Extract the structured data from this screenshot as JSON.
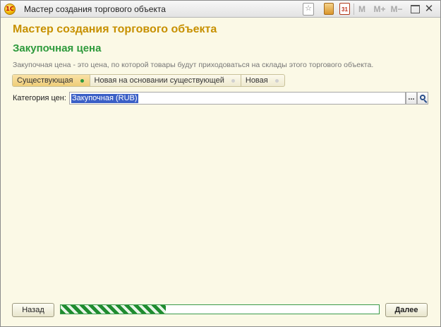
{
  "window": {
    "title": "Мастер создания торгового объекта",
    "app_icon_text": "1С",
    "toolbar": {
      "favorite_glyph": "☆",
      "calendar_text": "31",
      "m_label": "M",
      "m_plus_label": "M+",
      "m_minus_label": "M−",
      "close_glyph": "✕"
    }
  },
  "header": {
    "title": "Мастер создания торгового объекта",
    "page_title": "Закупочная цена",
    "description": "Закупочная цена - это цена, по которой товары будут приходоваться на склады этого торгового объекта."
  },
  "tabs": [
    {
      "label": "Существующая",
      "active": true
    },
    {
      "label": "Новая на основании существующей",
      "active": false
    },
    {
      "label": "Новая",
      "active": false
    }
  ],
  "form": {
    "price_category_label": "Категория цен:",
    "price_category_value": "Закупочная (RUB)",
    "select_button_label": "..."
  },
  "footer": {
    "back_label": "Назад",
    "next_label": "Далее",
    "progress": 0.33
  },
  "colors": {
    "title_accent": "#c79000",
    "page_title": "#2e9a3c",
    "background": "#fbf9e6"
  }
}
